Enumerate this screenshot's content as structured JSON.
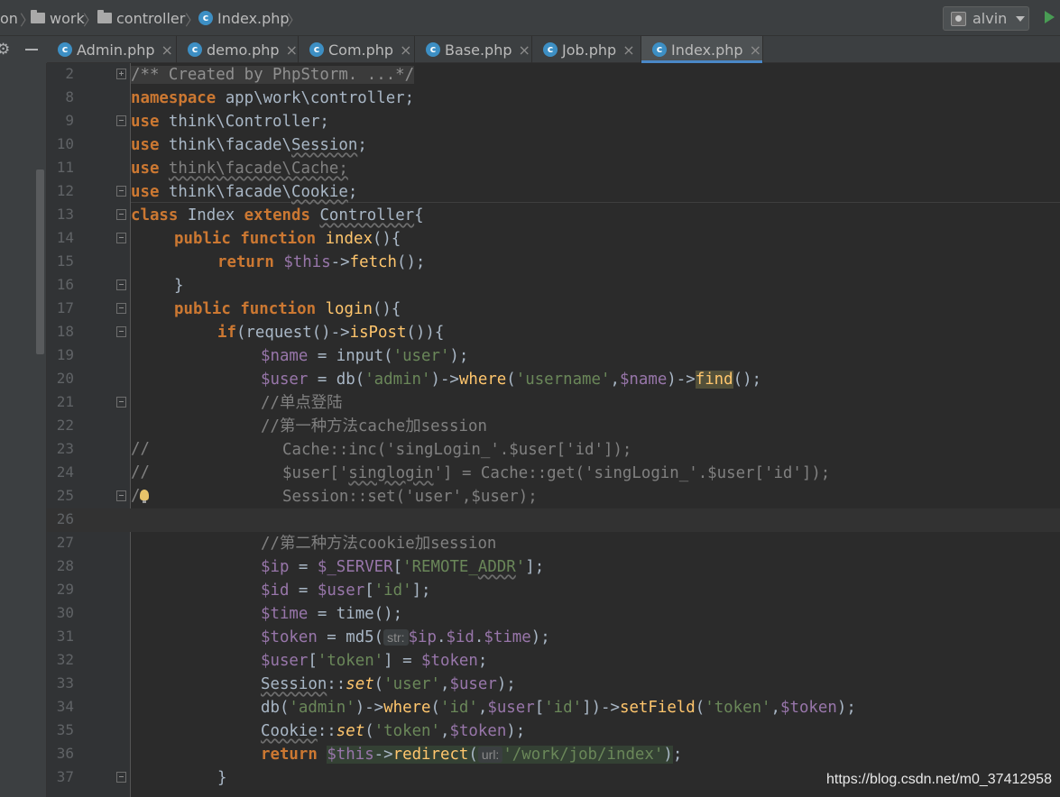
{
  "breadcrumb": {
    "project_fragment": "on",
    "folder1": "work",
    "folder2": "controller",
    "file": "Index.php"
  },
  "vcs": {
    "user": "alvin"
  },
  "tabs": [
    {
      "label": "Admin.php",
      "close": "×"
    },
    {
      "label": "demo.php",
      "close": "×"
    },
    {
      "label": "Com.php",
      "close": "×"
    },
    {
      "label": "Base.php",
      "close": "×"
    },
    {
      "label": "Job.php",
      "close": "×"
    },
    {
      "label": "Index.php",
      "close": "×",
      "active": true
    }
  ],
  "gutter": {
    "line_numbers": [
      "2",
      "8",
      "9",
      "10",
      "11",
      "12",
      "13",
      "14",
      "15",
      "16",
      "17",
      "18",
      "19",
      "20",
      "21",
      "22",
      "23",
      "24",
      "25",
      "26",
      "27",
      "28",
      "29",
      "30",
      "31",
      "32",
      "33",
      "34",
      "35",
      "36",
      "37"
    ],
    "current_line": "26"
  },
  "code": {
    "l2": {
      "folded": "/** Created by PhpStorm. ...*/"
    },
    "l8": {
      "kw": "namespace",
      "rest": " app\\work\\controller;"
    },
    "l9": {
      "kw": "use",
      "rest": " think\\Controller;"
    },
    "l10": {
      "kw": "use",
      "pre": " think\\facade\\",
      "ul": "Session",
      "post": ";"
    },
    "l11": {
      "kw": "use",
      "sp": " ",
      "dim": "think\\facade\\Cache;"
    },
    "l12": {
      "kw": "use",
      "pre": " think\\facade\\",
      "ul": "Cookie",
      "post": ";"
    },
    "l13": {
      "kw1": "class",
      "name": " Index ",
      "kw2": "extends",
      "sp": " ",
      "ul": "Controller",
      "post": "{"
    },
    "l14": {
      "kw1": "public",
      "kw2": "function",
      "fn": "index",
      "post": "(){"
    },
    "l15": {
      "kw": "return",
      "var": "$this",
      "arrow": "->",
      "fn": "fetch",
      "post": "();"
    },
    "l16": {
      "text": "}"
    },
    "l17": {
      "kw1": "public",
      "kw2": "function",
      "fn": "login",
      "post": "(){"
    },
    "l18": {
      "kw": "if",
      "a": "(request()->",
      "fn": "isPost",
      "b": "()){"
    },
    "l19": {
      "var": "$name",
      "a": " = input(",
      "str": "'user'",
      "b": ");"
    },
    "l20": {
      "var1": "$user",
      "a": " = db(",
      "str1": "'admin'",
      "b": ")->",
      "fn1": "where",
      "c": "(",
      "str2": "'username'",
      "d": ",",
      "var2": "$name",
      "e": ")->",
      "fn2": "find",
      "f": "();"
    },
    "l21": {
      "comment": "//单点登陆"
    },
    "l22": {
      "comment": "//第一种方法cache加session"
    },
    "l23": {
      "slash": "//",
      "text": "Cache::inc('singLogin_'.$user['id']);"
    },
    "l24": {
      "slash": "//",
      "pre": "$user['",
      "ul": "singlogin",
      "post": "'] = Cache::get('singLogin_'.$user['id']);"
    },
    "l25": {
      "slash": "/",
      "text": "Session::set('user',$user);"
    },
    "l26": {
      "text": ""
    },
    "l27": {
      "comment": "//第二种方法cookie加session"
    },
    "l28": {
      "var1": "$ip",
      "a": " = ",
      "var2": "$_SERVER",
      "b": "[",
      "str_a": "'REMOTE_",
      "str_ul": "ADDR",
      "str_b": "'",
      "c": "];"
    },
    "l29": {
      "var1": "$id",
      "a": " = ",
      "var2": "$user",
      "b": "[",
      "str": "'id'",
      "c": "];"
    },
    "l30": {
      "var": "$time",
      "a": " = time();"
    },
    "l31": {
      "var1": "$token",
      "a": " = md5(",
      "hint": "str:",
      "var2": "$ip",
      "b": ".",
      "var3": "$id",
      "c": ".",
      "var4": "$time",
      "d": ");"
    },
    "l32": {
      "var1": "$user",
      "a": "[",
      "str": "'token'",
      "b": "] = ",
      "var2": "$token",
      "c": ";"
    },
    "l33": {
      "ul": "Session",
      "a": "::",
      "fn": "set",
      "b": "(",
      "str": "'user'",
      "c": ",",
      "var": "$user",
      "d": ");"
    },
    "l34": {
      "a": "db(",
      "str1": "'admin'",
      "b": ")->",
      "fn1": "where",
      "c": "(",
      "str2": "'id'",
      "d": ",",
      "var1": "$user",
      "e": "[",
      "str3": "'id'",
      "f": "])->",
      "fn2": "setField",
      "g": "(",
      "str4": "'token'",
      "h": ",",
      "var2": "$token",
      "i": ");"
    },
    "l35": {
      "ul": "Cookie",
      "a": "::",
      "fn": "set",
      "b": "(",
      "str": "'token'",
      "c": ",",
      "var": "$token",
      "d": ");"
    },
    "l36": {
      "kw": "return",
      "var": "$this",
      "arrow": "->",
      "fn": "redirect",
      "a": "(",
      "hint": "url:",
      "str": "'/work/job/index'",
      "b": ");"
    },
    "l37": {
      "text": "}"
    }
  },
  "watermark": "https://blog.csdn.net/m0_37412958"
}
